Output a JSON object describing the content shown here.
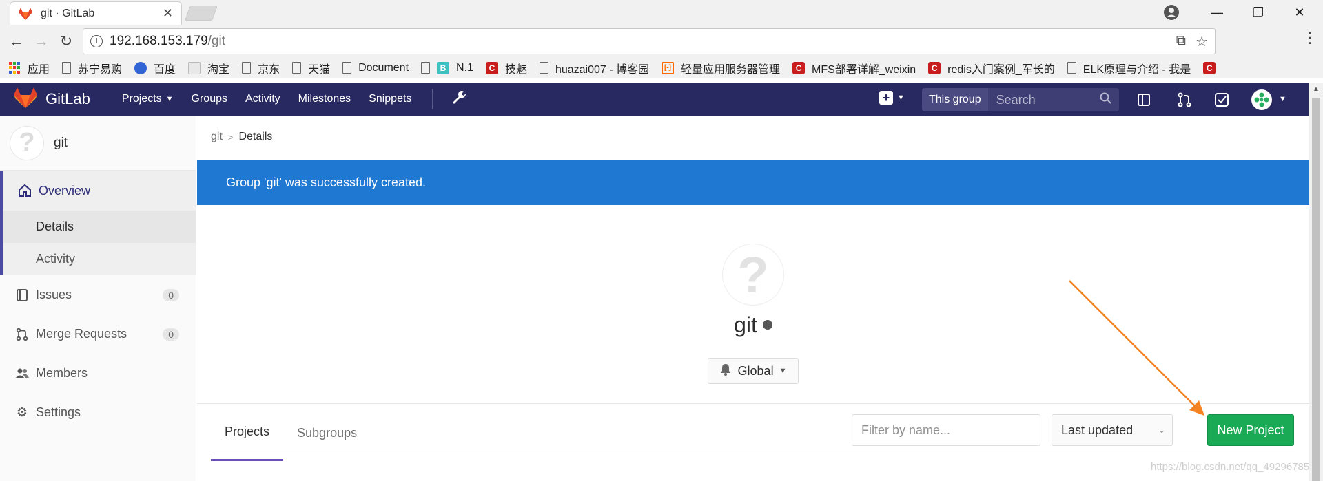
{
  "browser": {
    "tab_title": "git · GitLab",
    "tab_close": "✕",
    "url_host": "192.168.153.179",
    "url_path": "/git",
    "window_min": "—",
    "window_restore": "❐",
    "window_close": "✕"
  },
  "bookmarks": [
    {
      "label": "应用",
      "icon": "apps-icon"
    },
    {
      "label": "苏宁易购",
      "icon": "page-icon"
    },
    {
      "label": "百度",
      "icon": "baidu-icon"
    },
    {
      "label": "淘宝",
      "icon": "taobao-icon"
    },
    {
      "label": "京东",
      "icon": "page-icon"
    },
    {
      "label": "天猫",
      "icon": "page-icon"
    },
    {
      "label": "Document",
      "icon": "page-icon"
    },
    {
      "label": "N.1",
      "icon": "b-icon"
    },
    {
      "label": "技魅",
      "icon": "csdn-icon"
    },
    {
      "label": "huazai007 - 博客园",
      "icon": "page-icon"
    },
    {
      "label": "轻量应用服务器管理",
      "icon": "aliyun-icon"
    },
    {
      "label": "MFS部署详解_weixin",
      "icon": "csdn-icon"
    },
    {
      "label": "redis入门案例_军长的",
      "icon": "csdn-icon"
    },
    {
      "label": "ELK原理与介绍 - 我是",
      "icon": "page-icon"
    }
  ],
  "header": {
    "brand": "GitLab",
    "nav": [
      {
        "label": "Projects",
        "has_caret": true
      },
      {
        "label": "Groups"
      },
      {
        "label": "Activity"
      },
      {
        "label": "Milestones"
      },
      {
        "label": "Snippets"
      }
    ],
    "search_scope": "This group",
    "search_placeholder": "Search"
  },
  "sidebar": {
    "group_name": "git",
    "overview": "Overview",
    "sub_items": [
      "Details",
      "Activity"
    ],
    "items": [
      {
        "label": "Issues",
        "count": "0"
      },
      {
        "label": "Merge Requests",
        "count": "0"
      },
      {
        "label": "Members"
      },
      {
        "label": "Settings"
      }
    ]
  },
  "main": {
    "breadcrumb_root": "git",
    "breadcrumb_current": "Details",
    "flash": "Group 'git' was successfully created.",
    "group_title": "git",
    "notification_level": "Global",
    "tabs": [
      "Projects",
      "Subgroups"
    ],
    "filter_placeholder": "Filter by name...",
    "sort_selected": "Last updated",
    "new_project": "New Project",
    "watermark": "https://blog.csdn.net/qq_49296785"
  },
  "colors": {
    "header_bg": "#292961",
    "flash_bg": "#1f78d1",
    "new_project_bg": "#1aaa55",
    "arrow": "#f58220"
  }
}
